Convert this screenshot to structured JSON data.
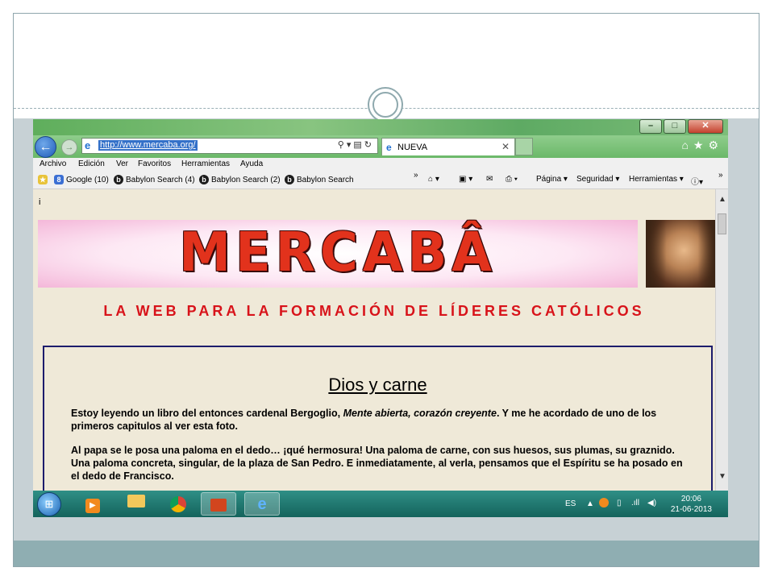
{
  "browser": {
    "url": "http://www.mercaba.org/",
    "tab_label": "NUEVA",
    "menu": [
      "Archivo",
      "Edición",
      "Ver",
      "Favoritos",
      "Herramientas",
      "Ayuda"
    ],
    "favorites": [
      {
        "label": "Google (10)",
        "icon": "google-icon"
      },
      {
        "label": "Babylon Search (4)",
        "icon": "babylon-icon"
      },
      {
        "label": "Babylon Search (2)",
        "icon": "babylon-icon"
      },
      {
        "label": "Babylon Search",
        "icon": "babylon-icon"
      }
    ],
    "commands": [
      "Página ▾",
      "Seguridad ▾",
      "Herramientas ▾"
    ]
  },
  "page": {
    "stray_char": "i",
    "banner_text": "MERCABÂ",
    "tagline": "LA WEB PARA LA FORMACIÓN DE LÍDERES CATÓLICOS",
    "article": {
      "title": "Dios y carne",
      "p1_start": "Estoy leyendo un libro del entonces cardenal Bergoglio, ",
      "p1_italic": "Mente abierta, corazón creyente",
      "p1_end": ". Y me he acordado de uno de los primeros capitulos al ver esta foto.",
      "p2": "Al papa se le posa una paloma en el dedo… ¡qué hermosura! Una paloma de carne, con sus huesos, sus plumas, su graznido. Una paloma concreta, singular, de la plaza de San Pedro. E inmediatamente, al verla, pensamos que el Espíritu se ha posado en el dedo de Francisco."
    }
  },
  "taskbar": {
    "language": "ES",
    "time": "20:06",
    "date": "21-06-2013"
  }
}
